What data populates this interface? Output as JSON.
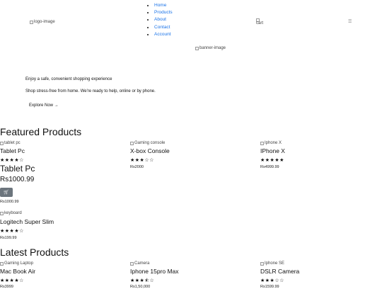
{
  "header": {
    "logo_alt": "logo-image",
    "nav": [
      "Home",
      "Products",
      "About",
      "Contact",
      "Account"
    ],
    "cart_alt": "cart",
    "menu_glyph": "☰"
  },
  "hero": {
    "banner_alt": "banner-image",
    "tagline": "Enjoy a safe, convenient shopping experience",
    "subtext": "Shop stress-free from home. We're ready to help, online or by phone.",
    "cta": "Explore Now →"
  },
  "featured": {
    "title": "Featured Products",
    "items": [
      {
        "alt": "tablet pc",
        "name": "Tablet Pc",
        "stars": "★★★★☆",
        "price": "Rs1000.99"
      },
      {
        "alt": "Gaming console",
        "name": "X-box Console",
        "stars": "★★★☆☆",
        "price": "Rs2000"
      },
      {
        "alt": "Iphone X",
        "name": "IPhone X",
        "stars": "★★★★★",
        "price": "Rs4999.99"
      },
      {
        "alt": "keyboard",
        "name": "Logitech Super Slim",
        "stars": "★★★★☆",
        "price": "Rs199.99"
      }
    ],
    "detail": {
      "name": "Tablet Pc",
      "price": "Rs1000.99",
      "button_icon": "cart-icon",
      "button_glyph": "🛒",
      "price_small": "Rs1000.99"
    }
  },
  "latest": {
    "title": "Latest Products",
    "items": [
      {
        "alt": "Gaming Laptop",
        "name": "Mac Book Air",
        "stars": "★★★★☆",
        "price": "Rs3999"
      },
      {
        "alt": "Camera",
        "name": "Iphone 15pro Max",
        "stars": "★★★⯪☆",
        "price": "Rs1,50,000"
      },
      {
        "alt": "Iphone SE",
        "name": "DSLR Camera",
        "stars": "★★★☆☆",
        "price": "Rs1599.99"
      }
    ]
  }
}
